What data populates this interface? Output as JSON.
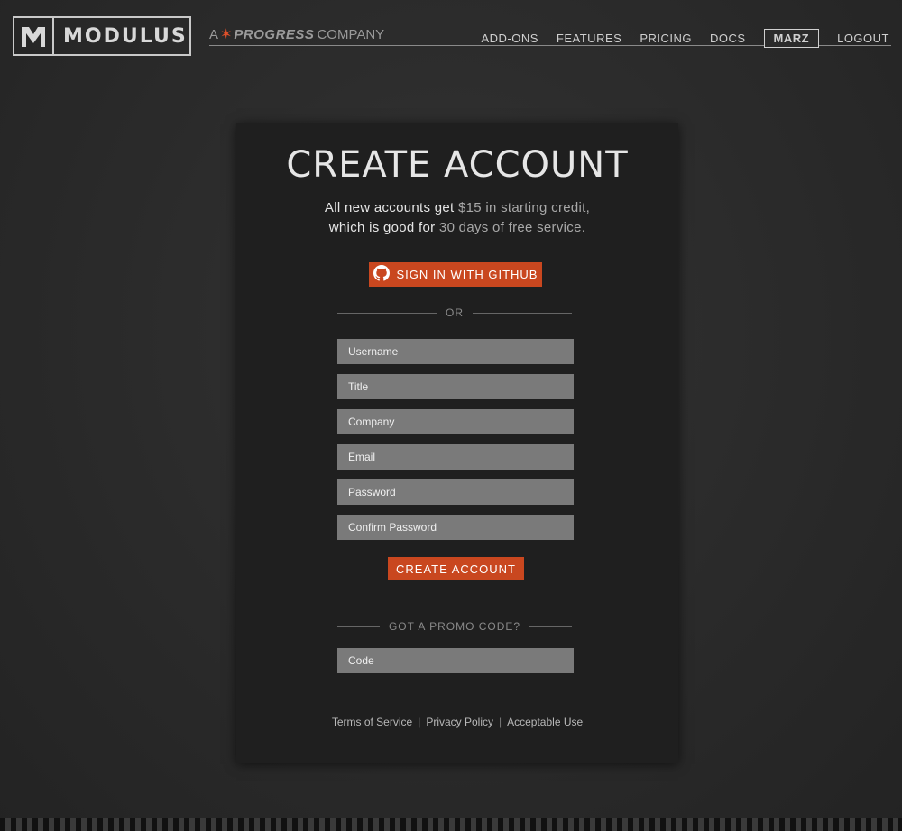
{
  "header": {
    "logo_text": "MODULUS",
    "tagline_prefix": "A",
    "tagline_brand": "PROGRESS",
    "tagline_suffix": "COMPANY",
    "nav": {
      "addons": "ADD-ONS",
      "features": "FEATURES",
      "pricing": "PRICING",
      "docs": "DOCS",
      "user": "MARZ",
      "logout": "LOGOUT"
    }
  },
  "form": {
    "title": "CREATE ACCOUNT",
    "intro_line1_a": "All new accounts get ",
    "intro_line1_b": "$15 in starting credit,",
    "intro_line2_a": "which is good for ",
    "intro_line2_b": "30 days of free service.",
    "github_button": "SIGN IN WITH GITHUB",
    "or_label": "OR",
    "fields": {
      "username": "Username",
      "title": "Title",
      "company": "Company",
      "email": "Email",
      "password": "Password",
      "confirm_password": "Confirm Password"
    },
    "create_button": "CREATE ACCOUNT",
    "promo_label": "GOT A PROMO CODE?",
    "code_placeholder": "Code"
  },
  "footer": {
    "terms": "Terms of Service",
    "privacy": "Privacy Policy",
    "acceptable": "Acceptable Use"
  },
  "colors": {
    "accent": "#c9471f",
    "background": "#2b2b2b",
    "card": "#1f1f1f",
    "field": "#7a7a7a"
  }
}
